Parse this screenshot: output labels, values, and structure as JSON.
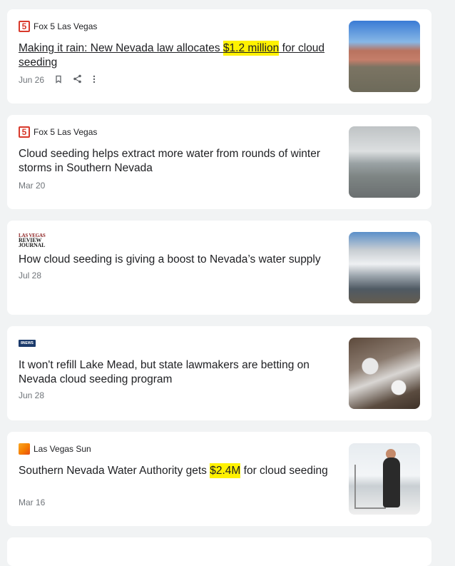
{
  "cards": [
    {
      "source": "Fox 5 Las Vegas",
      "source_logo": "fox5-logo",
      "headline_pre": "Making it rain: New Nevada law allocates ",
      "headline_highlight": "$1.2 million",
      "headline_post": " for cloud seeding",
      "date": "Jun 26",
      "thumbnail": "red-rock-landscape"
    },
    {
      "source": "Fox 5 Las Vegas",
      "source_logo": "fox5-logo",
      "headline": "Cloud seeding helps extract more water from rounds of winter storms in Southern Nevada",
      "date": "Mar 20",
      "thumbnail": "snowy-mountain-road"
    },
    {
      "source_logo": "las-vegas-review-journal-logo",
      "source_logo_text": [
        "LAS VEGAS",
        "REVIEW JOURNAL"
      ],
      "headline": "How cloud seeding is giving a boost to Nevada’s water supply",
      "date": "Jul 28",
      "thumbnail": "cloudy-sky-town"
    },
    {
      "source_logo": "8news-logo",
      "source_logo_text": "8NEWS",
      "headline": "It won't refill Lake Mead, but state lawmakers are betting on Nevada cloud seeding program",
      "date": "Jun 28",
      "thumbnail": "snowy-aerial-town"
    },
    {
      "source": "Las Vegas Sun",
      "source_logo": "las-vegas-sun-logo",
      "headline_pre": "Southern Nevada Water Authority gets ",
      "headline_highlight": "$2.4M",
      "headline_post": " for cloud seeding",
      "date": "Mar 16",
      "thumbnail": "man-in-snow-with-equipment"
    }
  ],
  "colors": {
    "highlight": "#fff200",
    "background": "#f1f3f4",
    "card": "#ffffff",
    "text": "#202124",
    "meta": "#70757a"
  },
  "icons": [
    "bookmark-icon",
    "share-icon",
    "more-vert-icon"
  ]
}
